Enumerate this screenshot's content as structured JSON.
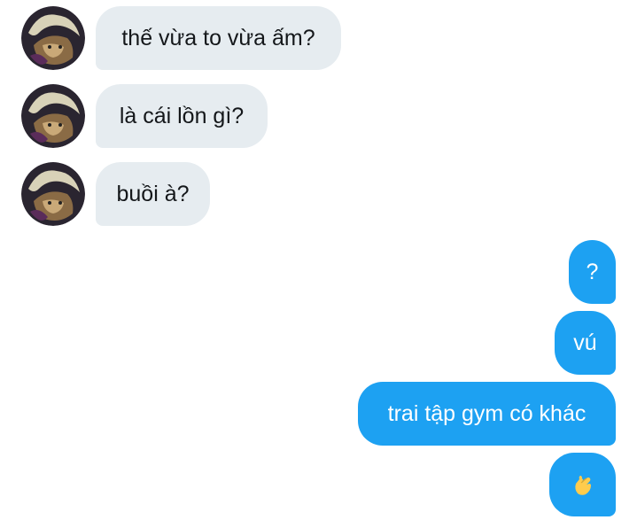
{
  "conversation": {
    "incoming": [
      {
        "text": "thế vừa to vừa ấm?",
        "avatar_icon": "user-avatar-icon"
      },
      {
        "text": "là cái lồn gì?",
        "avatar_icon": "user-avatar-icon"
      },
      {
        "text": "buồi à?",
        "avatar_icon": "user-avatar-icon"
      }
    ],
    "outgoing": [
      {
        "text": "?"
      },
      {
        "text": "vú"
      },
      {
        "text": "trai tập gym có khác"
      },
      {
        "text": "🫰",
        "icon": "finger-heart-emoji-icon"
      }
    ]
  },
  "colors": {
    "incoming_bubble": "#e6ecf0",
    "incoming_text": "#14171a",
    "outgoing_bubble": "#1da1f2",
    "outgoing_text": "#ffffff"
  }
}
